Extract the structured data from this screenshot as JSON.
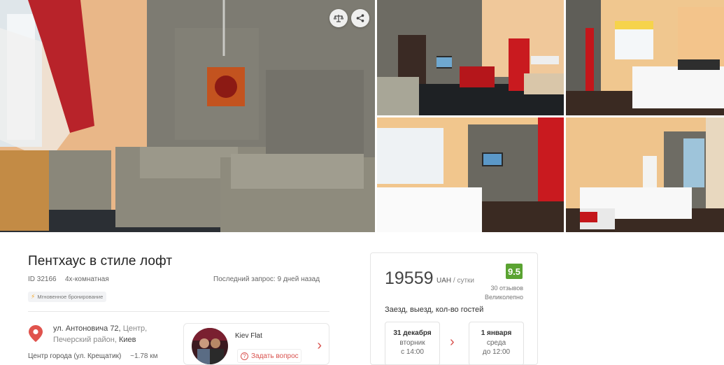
{
  "gallery": {
    "photos": [
      "living-room",
      "kitchen",
      "bedroom",
      "bedroom",
      "bedroom"
    ],
    "compare_icon": "scales-icon",
    "share_icon": "share-icon"
  },
  "listing": {
    "title": "Пентхаус в стиле лофт",
    "id": "ID 32166",
    "rooms": "4х-комнатная",
    "last_request": "Последний запрос: 9 дней назад",
    "instant_badge": "Мгновенное бронирование",
    "address_street": "ул. Антоновича 72,",
    "address_area1": "Центр,",
    "address_area2": "Печерский район,",
    "address_city": "Киев",
    "center_label": "Центр города (ул. Крещатик)",
    "center_distance": "~1.78 км"
  },
  "host": {
    "name": "Kiev Flat",
    "ask_label": "Задать вопрос"
  },
  "booking": {
    "price": "19559",
    "currency": "UAH",
    "per": "/ сутки",
    "score": "9.5",
    "reviews": "30 отзывов",
    "rating_word": "Великолепно",
    "checkin_label": "Заезд, выезд, кол-во гостей",
    "checkin_date": "31 декабря",
    "checkin_day": "вторник",
    "checkin_time": "с 14:00",
    "checkout_date": "1 января",
    "checkout_day": "среда",
    "checkout_time": "до 12:00"
  },
  "colors": {
    "accent": "#d9534f",
    "score_bg": "#5aa331",
    "badge_bolt": "#f5a623"
  }
}
